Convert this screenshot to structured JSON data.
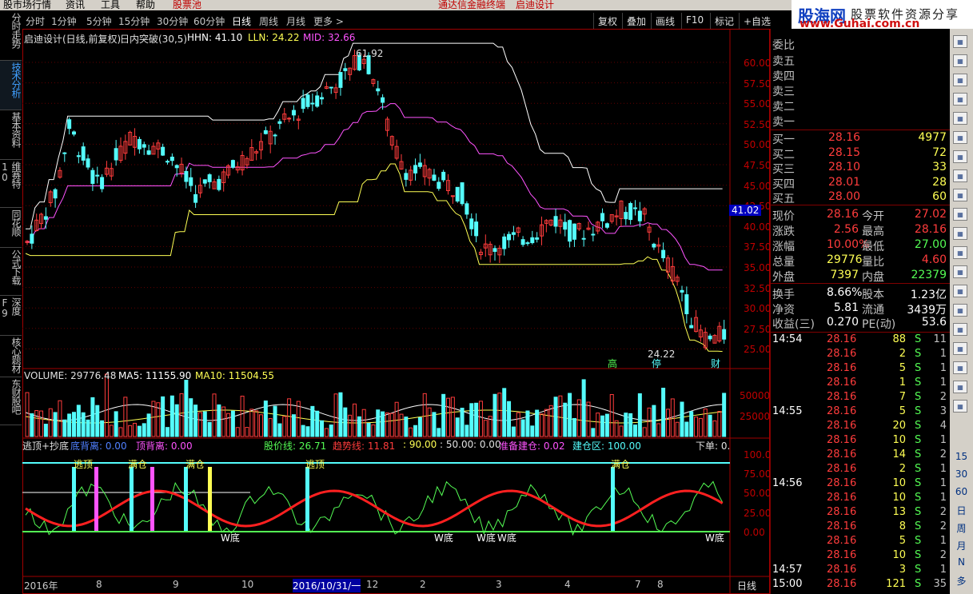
{
  "menu": {
    "items": [
      "股市场行情",
      "资讯",
      "工具",
      "帮助",
      "股票池"
    ],
    "center1": "通达信金融终端",
    "center2": "启迪设计"
  },
  "logo": {
    "cn": "股海网",
    "slogan": "股票软件资源分享",
    "url": "www.Guhai.com.cn"
  },
  "periods": [
    "分时",
    "1分钟",
    "5分钟",
    "15分钟",
    "30分钟",
    "60分钟",
    "日线",
    "周线",
    "月线",
    "更多 >"
  ],
  "active_period": "日线",
  "toolbar": [
    "复权",
    "叠加",
    "画线",
    "F10",
    "标记",
    "+自选"
  ],
  "side_tabs": [
    "分时走势",
    "技术分析",
    "基本资料",
    "维赛特10",
    "同花顺",
    "公式下载",
    "深度F9",
    "核心题材",
    "东财股吧"
  ],
  "main_header": {
    "title": "启迪设计(日线,前复权)",
    "indicator": "日内突破(30,5)",
    "hhn": "HHN: 41.10",
    "lln": "LLN: 24.22",
    "mid": "MID: 32.66"
  },
  "price_axis": [
    "60.00",
    "57.50",
    "55.00",
    "52.50",
    "50.00",
    "47.50",
    "45.00",
    "42.50",
    "40.00",
    "37.50",
    "35.00",
    "32.50",
    "30.00",
    "27.50",
    "25.00"
  ],
  "price_tag": "41.02",
  "high_label": "61.92",
  "low_label": "24.22",
  "event_labels": [
    "高",
    "停",
    "财"
  ],
  "volume": {
    "header": "VOLUME: 29776.48",
    "ma5": "MA5: 11155.90",
    "ma10": "MA10: 11504.55",
    "axis": [
      "50000",
      "25000"
    ]
  },
  "osc": {
    "name": "逃顶+抄底",
    "d1": "底背离: 0.00",
    "d2": "顶背离: 0.00",
    "d3": "股价线: 26.71",
    "d4": "趋势线: 11.81",
    "d5": ": 90.00",
    "d6": ": 50.00",
    "d7": ": 0.00",
    "d8": "准备建仓: 0.02",
    "d9": "建仓区: 100.00",
    "d10": "下单: 0.",
    "axis": [
      "100.00",
      "75.00",
      "50.00",
      "25.00",
      "0.00"
    ],
    "tags": [
      "逃顶",
      "满仓",
      "满仓",
      "逃顶",
      "满仓",
      "W底",
      "W底",
      "W底",
      "W底",
      "W底"
    ]
  },
  "date_axis": {
    "items": [
      "2016年",
      "8",
      "9",
      "10",
      "2016/10/31/一",
      "12",
      "2",
      "3",
      "4",
      "7",
      "8"
    ],
    "right": "日线"
  },
  "quotes": {
    "weibi": "委比",
    "sells": [
      {
        "l": "卖五"
      },
      {
        "l": "卖四"
      },
      {
        "l": "卖三"
      },
      {
        "l": "卖二"
      },
      {
        "l": "卖一"
      }
    ],
    "buys": [
      {
        "l": "买一",
        "p": "28.16",
        "v": "4977"
      },
      {
        "l": "买二",
        "p": "28.15",
        "v": "72"
      },
      {
        "l": "买三",
        "p": "28.10",
        "v": "33"
      },
      {
        "l": "买四",
        "p": "28.01",
        "v": "28"
      },
      {
        "l": "买五",
        "p": "28.00",
        "v": "60"
      }
    ],
    "stats": [
      {
        "a": "现价",
        "av": "28.16",
        "b": "今开",
        "bv": "27.02"
      },
      {
        "a": "涨跌",
        "av": "2.56",
        "b": "最高",
        "bv": "28.16"
      },
      {
        "a": "涨幅",
        "av": "10.00%",
        "b": "最低",
        "bv": "27.00"
      },
      {
        "a": "总量",
        "av": "29776",
        "b": "量比",
        "bv": "4.60"
      },
      {
        "a": "外盘",
        "av": "7397",
        "b": "内盘",
        "bv": "22379"
      }
    ],
    "stats2": [
      {
        "a": "换手",
        "av": "8.66%",
        "b": "股本",
        "bv": "1.23亿"
      },
      {
        "a": "净资",
        "av": "5.81",
        "b": "流通",
        "bv": "3439万"
      },
      {
        "a": "收益(三)",
        "av": "0.270",
        "b": "PE(动)",
        "bv": "53.6"
      }
    ]
  },
  "ticks": [
    {
      "t": "14:54",
      "p": "28.16",
      "v": "88",
      "s": "S",
      "n": "11"
    },
    {
      "t": "",
      "p": "28.16",
      "v": "2",
      "s": "S",
      "n": "1"
    },
    {
      "t": "",
      "p": "28.16",
      "v": "5",
      "s": "S",
      "n": "1"
    },
    {
      "t": "",
      "p": "28.16",
      "v": "1",
      "s": "S",
      "n": "1"
    },
    {
      "t": "",
      "p": "28.16",
      "v": "7",
      "s": "S",
      "n": "2"
    },
    {
      "t": "14:55",
      "p": "28.16",
      "v": "5",
      "s": "S",
      "n": "3"
    },
    {
      "t": "",
      "p": "28.16",
      "v": "20",
      "s": "S",
      "n": "4"
    },
    {
      "t": "",
      "p": "28.16",
      "v": "10",
      "s": "S",
      "n": "1"
    },
    {
      "t": "",
      "p": "28.16",
      "v": "14",
      "s": "S",
      "n": "2"
    },
    {
      "t": "",
      "p": "28.16",
      "v": "2",
      "s": "S",
      "n": "1"
    },
    {
      "t": "14:56",
      "p": "28.16",
      "v": "10",
      "s": "S",
      "n": "1"
    },
    {
      "t": "",
      "p": "28.16",
      "v": "10",
      "s": "S",
      "n": "1"
    },
    {
      "t": "",
      "p": "28.16",
      "v": "13",
      "s": "S",
      "n": "2"
    },
    {
      "t": "",
      "p": "28.16",
      "v": "8",
      "s": "S",
      "n": "2"
    },
    {
      "t": "",
      "p": "28.16",
      "v": "5",
      "s": "S",
      "n": "1"
    },
    {
      "t": "",
      "p": "28.16",
      "v": "10",
      "s": "S",
      "n": "2"
    },
    {
      "t": "14:57",
      "p": "28.16",
      "v": "3",
      "s": "S",
      "n": "1"
    },
    {
      "t": "15:00",
      "p": "28.16",
      "v": "121",
      "s": "S",
      "n": "35"
    }
  ],
  "side_icon_text": [
    "15",
    "30",
    "60",
    "日",
    "周",
    "月",
    "N",
    "多"
  ],
  "colors": {
    "up": "#ff3c3c",
    "down": "#54fcfc",
    "yellow": "#ffff54",
    "magenta": "#ff54ff",
    "white": "#ffffff",
    "border": "#800000"
  }
}
